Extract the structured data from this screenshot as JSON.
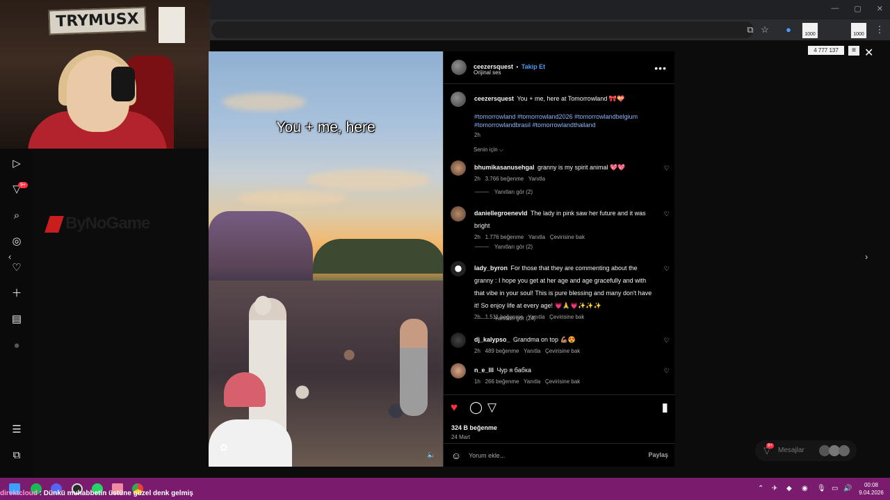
{
  "webcam": {
    "sign_text": "TRYMUSX"
  },
  "brand": {
    "name": "ByNoGame"
  },
  "sidebar": {
    "notification_badge": "9+"
  },
  "post": {
    "username": "ceezersquest",
    "separator": "•",
    "follow_label": "Takip Et",
    "audio": "Orijinal ses",
    "video_caption": "You + me, here",
    "caption_text": "You + me, here at Tomorrowland 🎀💝",
    "hashtags_line1": "#tomorrowland #tomorrowland2026 #tomorrowlandbelgium",
    "hashtags_line2": "#tomorrowlandbrasil #tomorrowlandthailand",
    "caption_time": "2h",
    "sort_label": "Senin için ⌵",
    "likes": "324 B beğenme",
    "date": "24 Mart",
    "comment_placeholder": "Yorum ekle...",
    "share_label": "Paylaş"
  },
  "comments": [
    {
      "user": "bhumikasanusehgal",
      "text": "granny is my spirit animal 💖💖",
      "time": "2h",
      "likes": "3.766 beğenme",
      "reply": "Yanıtla",
      "translate": "",
      "replies": "Yanıtları gör (2)"
    },
    {
      "user": "daniellegroenevld",
      "text": "The lady in pink saw her future and it was bright",
      "time": "2h",
      "likes": "1.776 beğenme",
      "reply": "Yanıtla",
      "translate": "Çevirisine bak",
      "replies": "Yanıtları gör (2)"
    },
    {
      "user": "lady_byron",
      "text": "For those that they are commenting about the granny : I hope you get at her age and age gracefully and with that vibe in your soul! This is pure blessing and many don't have it! So enjoy life at every age! 💗🙏💗✨✨✨",
      "time": "2h",
      "likes": "1.511 beğenme",
      "reply": "Yanıtla",
      "translate": "Çevirisine bak",
      "replies": "Yanıtları gör (24)"
    },
    {
      "user": "dj_kalypso_",
      "text": "Grandma on top 💪🏽😍",
      "time": "2h",
      "likes": "489 beğenme",
      "reply": "Yanıtla",
      "translate": "Çevirisine bak",
      "replies": ""
    },
    {
      "user": "n_e_lll",
      "text": "Чур я бабка",
      "time": "1h",
      "likes": "266 beğenme",
      "reply": "Yanıtla",
      "translate": "Çevirisine bak",
      "replies": ""
    }
  ],
  "overlay": {
    "counter": "4 777 137",
    "cup_left": "1000",
    "cup_right": "1000",
    "messages_label": "Mesajlar",
    "messages_badge": "9+"
  },
  "taskbar": {
    "ticker_user": "direktcloud",
    "ticker_text": ": Dünkü muhabbetin üstüne güzel denk gelmiş",
    "time": "00:08",
    "date": "9.04.2026"
  },
  "colors": {
    "accent_blue": "#4c9cf5",
    "like_red": "#ff3040",
    "taskbar": "#7a1c6e"
  }
}
